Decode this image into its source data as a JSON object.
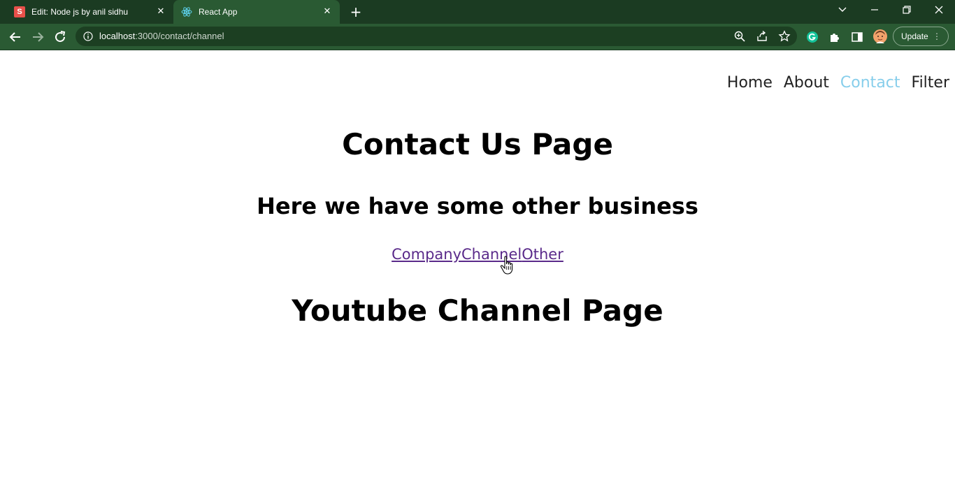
{
  "browser": {
    "tabs": [
      {
        "label": "Edit: Node js by anil sidhu",
        "favicon": "S"
      },
      {
        "label": "React App"
      }
    ],
    "url_host": "localhost",
    "url_path": ":3000/contact/channel",
    "update_label": "Update"
  },
  "nav": {
    "items": [
      {
        "label": "Home"
      },
      {
        "label": "About"
      },
      {
        "label": "Contact"
      },
      {
        "label": "Filter"
      }
    ]
  },
  "page": {
    "title": "Contact Us Page",
    "subtitle": "Here we have some other business",
    "links": [
      "Company",
      "Channel",
      "Other"
    ],
    "section_title": "Youtube Channel Page"
  },
  "colors": {
    "tabbar": "#1b3b22",
    "toolbar": "#2a5a33",
    "active_nav": "#87ceeb",
    "visited_link": "#5a2a8a"
  }
}
